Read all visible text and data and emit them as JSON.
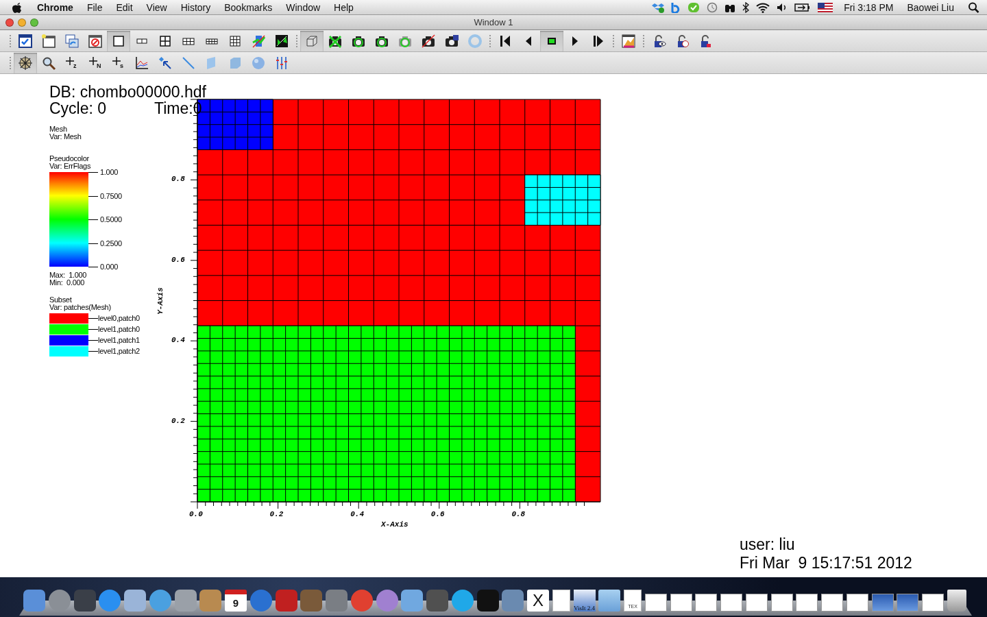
{
  "menu_bar": {
    "app": "Chrome",
    "menus": [
      "File",
      "Edit",
      "View",
      "History",
      "Bookmarks",
      "Window",
      "Help"
    ],
    "clock": "Fri 3:18 PM",
    "user": "Baowei Liu"
  },
  "window": {
    "title": "Window 1"
  },
  "toolbar_1": [
    {
      "buttons": [
        {
          "kind": "window-check",
          "selected": false
        },
        {
          "kind": "window-new",
          "selected": false
        },
        {
          "kind": "window-clone",
          "selected": false
        },
        {
          "kind": "window-delete",
          "selected": false
        },
        {
          "kind": "layout-1",
          "selected": true
        },
        {
          "kind": "layout-1x2",
          "selected": false
        },
        {
          "kind": "layout-2x2",
          "selected": false
        },
        {
          "kind": "layout-3x2",
          "selected": false
        },
        {
          "kind": "layout-4x2",
          "selected": false
        },
        {
          "kind": "layout-3x3",
          "selected": false
        },
        {
          "kind": "spin",
          "selected": false
        },
        {
          "kind": "lock-view",
          "selected": false
        }
      ]
    },
    {
      "buttons": [
        {
          "kind": "cube",
          "selected": true
        },
        {
          "kind": "camera-x",
          "selected": false
        },
        {
          "kind": "camera-spin",
          "selected": false
        },
        {
          "kind": "camera-black",
          "selected": false
        },
        {
          "kind": "camera-gray",
          "selected": false
        },
        {
          "kind": "camera-crossed",
          "selected": false
        },
        {
          "kind": "camera-save",
          "selected": false
        },
        {
          "kind": "sync",
          "selected": false
        }
      ]
    },
    {
      "buttons": [
        {
          "kind": "skip-back",
          "selected": false
        },
        {
          "kind": "back",
          "selected": false
        },
        {
          "kind": "stop",
          "selected": true
        },
        {
          "kind": "play",
          "selected": false
        },
        {
          "kind": "skip-forward",
          "selected": false
        }
      ]
    },
    {
      "buttons": [
        {
          "kind": "palette",
          "selected": false
        }
      ]
    },
    {
      "buttons": [
        {
          "kind": "lock-eye",
          "selected": false
        },
        {
          "kind": "lock-clock",
          "selected": false
        },
        {
          "kind": "lock-tool",
          "selected": false
        }
      ]
    }
  ],
  "toolbar_2": [
    {
      "kind": "navigate",
      "selected": true
    },
    {
      "kind": "zoom",
      "selected": false
    },
    {
      "kind": "add-point",
      "label": "z",
      "selected": false
    },
    {
      "kind": "add-point",
      "label": "N",
      "selected": false
    },
    {
      "kind": "add-point",
      "label": "s",
      "selected": false
    },
    {
      "kind": "curve",
      "selected": false
    },
    {
      "kind": "pick",
      "selected": false
    },
    {
      "kind": "line",
      "selected": false
    },
    {
      "kind": "plane",
      "selected": false
    },
    {
      "kind": "box",
      "selected": false
    },
    {
      "kind": "sphere",
      "selected": false
    },
    {
      "kind": "sliders",
      "selected": false
    }
  ],
  "plot": {
    "database": "DB: chombo00000.hdf",
    "cycle": "Cycle: 0",
    "time": "Time:0",
    "mesh_legend": {
      "plot": "Mesh",
      "var": "Var: Mesh"
    },
    "pseudocolor_legend": {
      "plot": "Pseudocolor",
      "var": "Var: ErrFlags",
      "ticks": [
        "1.000",
        "0.7500",
        "0.5000",
        "0.2500",
        "0.000"
      ],
      "max": "Max:  1.000",
      "min": "Min:  0.000"
    },
    "subset_legend": {
      "plot": "Subset",
      "var": "Var: patches(Mesh)",
      "items": [
        {
          "label": "level0,patch0",
          "color": "#ff0000"
        },
        {
          "label": "level1,patch0",
          "color": "#00ff00"
        },
        {
          "label": "level1,patch1",
          "color": "#0000ff"
        },
        {
          "label": "level1,patch2",
          "color": "#00ffff"
        }
      ]
    },
    "x_axis": {
      "title": "X-Axis",
      "ticks": [
        "0.0",
        "0.2",
        "0.4",
        "0.6",
        "0.8"
      ]
    },
    "y_axis": {
      "title": "Y-Axis",
      "ticks": [
        "0.8",
        "0.6",
        "0.4",
        "0.2"
      ]
    },
    "user": "user: liu",
    "date": "Fri Mar  9 15:17:51 2012"
  },
  "dock": [
    {
      "kind": "tile",
      "color": "#5a8fd8"
    },
    {
      "kind": "circle",
      "color": "#8a8f96"
    },
    {
      "kind": "tile",
      "color": "#3a3f48"
    },
    {
      "kind": "circle",
      "color": "#2a8ff0"
    },
    {
      "kind": "tile",
      "color": "#9ab4d8"
    },
    {
      "kind": "circle",
      "color": "#4aa0e0"
    },
    {
      "kind": "tile",
      "color": "#9aa0a8"
    },
    {
      "kind": "tile",
      "color": "#b88a50"
    },
    {
      "kind": "calendar",
      "label": "9"
    },
    {
      "kind": "circle",
      "color": "#2a70d0"
    },
    {
      "kind": "tile",
      "color": "#c02020"
    },
    {
      "kind": "tile",
      "color": "#7a5a3a"
    },
    {
      "kind": "tile",
      "color": "#7a7e84"
    },
    {
      "kind": "circle",
      "color": "#e04030"
    },
    {
      "kind": "circle",
      "color": "#a080d0"
    },
    {
      "kind": "tile",
      "color": "#70a8e0"
    },
    {
      "kind": "tile",
      "color": "#505050"
    },
    {
      "kind": "circle",
      "color": "#20a8e8"
    },
    {
      "kind": "tile",
      "color": "#111111"
    },
    {
      "kind": "tile",
      "color": "#6a8ab0"
    },
    {
      "kind": "letter",
      "label": "X"
    },
    {
      "kind": "doc"
    },
    {
      "kind": "visit",
      "label": "VisIt 2.4"
    },
    {
      "kind": "folder"
    },
    {
      "kind": "doc",
      "label": "TEX"
    },
    {
      "kind": "thumb"
    },
    {
      "kind": "thumb"
    },
    {
      "kind": "thumb"
    },
    {
      "kind": "thumb"
    },
    {
      "kind": "thumb"
    },
    {
      "kind": "thumb"
    },
    {
      "kind": "thumb"
    },
    {
      "kind": "thumb"
    },
    {
      "kind": "thumb"
    },
    {
      "kind": "thumb-blue"
    },
    {
      "kind": "thumb-blue"
    },
    {
      "kind": "thumb"
    },
    {
      "kind": "trash"
    }
  ]
}
